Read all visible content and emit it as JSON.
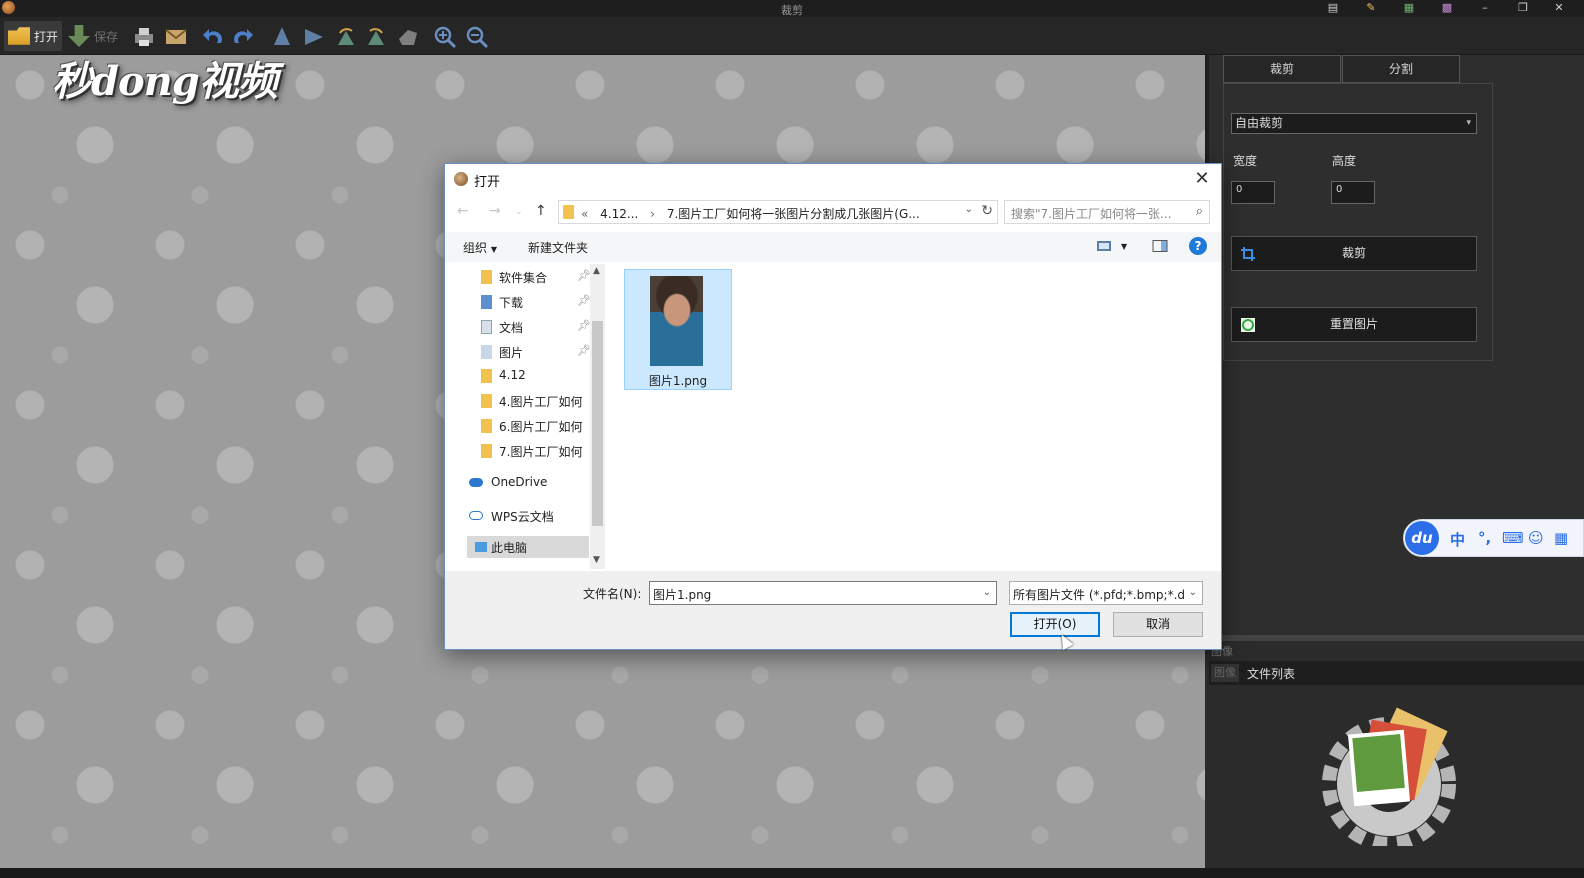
{
  "window": {
    "title": "裁剪"
  },
  "toolbar": {
    "open_label": "打开",
    "save_label": "保存"
  },
  "watermark": {
    "logo_text": "秒dong视频"
  },
  "right_panel": {
    "tabs": [
      "裁剪",
      "分割"
    ],
    "crop_mode": "自由裁剪",
    "width_label": "宽度",
    "height_label": "高度",
    "width_value": "0",
    "height_value": "0",
    "crop_button": "裁剪",
    "reset_button": "重置图片"
  },
  "bottom_panel": {
    "caption": "图像",
    "tab_image": "图像",
    "tab_file_list": "文件列表"
  },
  "ime": {
    "logo": "du",
    "mode": "中",
    "punct": "°,"
  },
  "dialog": {
    "title": "打开",
    "close_glyph": "✕",
    "breadcrumb": [
      "«",
      "4.12...",
      "›",
      "7.图片工厂如何将一张图片分割成几张图片(G..."
    ],
    "search_placeholder": "搜索\"7.图片工厂如何将一张...",
    "organize_label": "组织",
    "new_folder_label": "新建文件夹",
    "help_glyph": "?",
    "nav_items": [
      {
        "label": "软件集合",
        "pinned": true
      },
      {
        "label": "下载",
        "pinned": true
      },
      {
        "label": "文档",
        "pinned": true
      },
      {
        "label": "图片",
        "pinned": true
      },
      {
        "label": "4.12",
        "pinned": false
      },
      {
        "label": "4.图片工厂如何",
        "pinned": false
      },
      {
        "label": "6.图片工厂如何",
        "pinned": false
      },
      {
        "label": "7.图片工厂如何",
        "pinned": false
      },
      {
        "label": "OneDrive",
        "pinned": false
      },
      {
        "label": "WPS云文档",
        "pinned": false
      },
      {
        "label": "此电脑",
        "pinned": false
      }
    ],
    "files": [
      {
        "name": "图片1.png",
        "selected": true
      }
    ],
    "filename_label": "文件名(N):",
    "filename_value": "图片1.png",
    "filetype_value": "所有图片文件 (*.pfd;*.bmp;*.d",
    "open_button": "打开(O)",
    "cancel_button": "取消"
  },
  "colors": {
    "accent": "#0078d7",
    "selection": "#cce8ff",
    "folder": "#f2c24e",
    "ime_blue": "#2b6ee8"
  }
}
